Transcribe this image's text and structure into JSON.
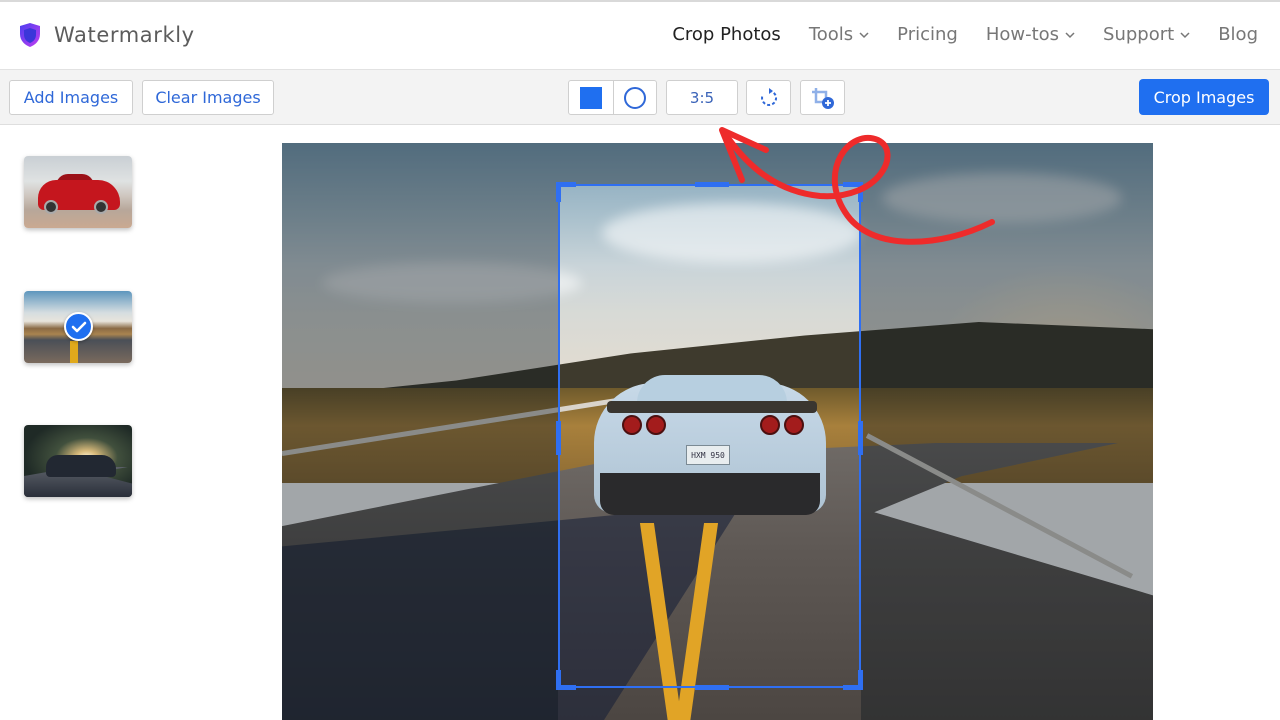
{
  "header": {
    "brand_name": "Watermarkly",
    "nav": [
      {
        "label": "Crop Photos",
        "active": true,
        "has_dropdown": false
      },
      {
        "label": "Tools",
        "active": false,
        "has_dropdown": true
      },
      {
        "label": "Pricing",
        "active": false,
        "has_dropdown": false
      },
      {
        "label": "How-tos",
        "active": false,
        "has_dropdown": true
      },
      {
        "label": "Support",
        "active": false,
        "has_dropdown": true
      },
      {
        "label": "Blog",
        "active": false,
        "has_dropdown": false
      }
    ]
  },
  "toolbar": {
    "add_images_label": "Add Images",
    "clear_images_label": "Clear Images",
    "shape_options": [
      {
        "icon": "square-icon",
        "selected": true
      },
      {
        "icon": "circle-icon",
        "selected": false
      }
    ],
    "aspect_ratio": "3:5",
    "rotate_icon": "rotate-icon",
    "add_crop_icon": "add-crop-icon",
    "crop_images_label": "Crop Images"
  },
  "thumbnails": [
    {
      "name": "red-sports-car",
      "selected": false
    },
    {
      "name": "white-car-on-road",
      "selected": true
    },
    {
      "name": "dark-car-sunset",
      "selected": false
    }
  ],
  "editor": {
    "license_plate": "HXM 950",
    "crop_shape": "rectangle",
    "crop_ratio": "3:5"
  },
  "colors": {
    "accent": "#1f6ff0",
    "link_text": "#2f68d8",
    "annotation_arrow": "#ee2b2b"
  }
}
